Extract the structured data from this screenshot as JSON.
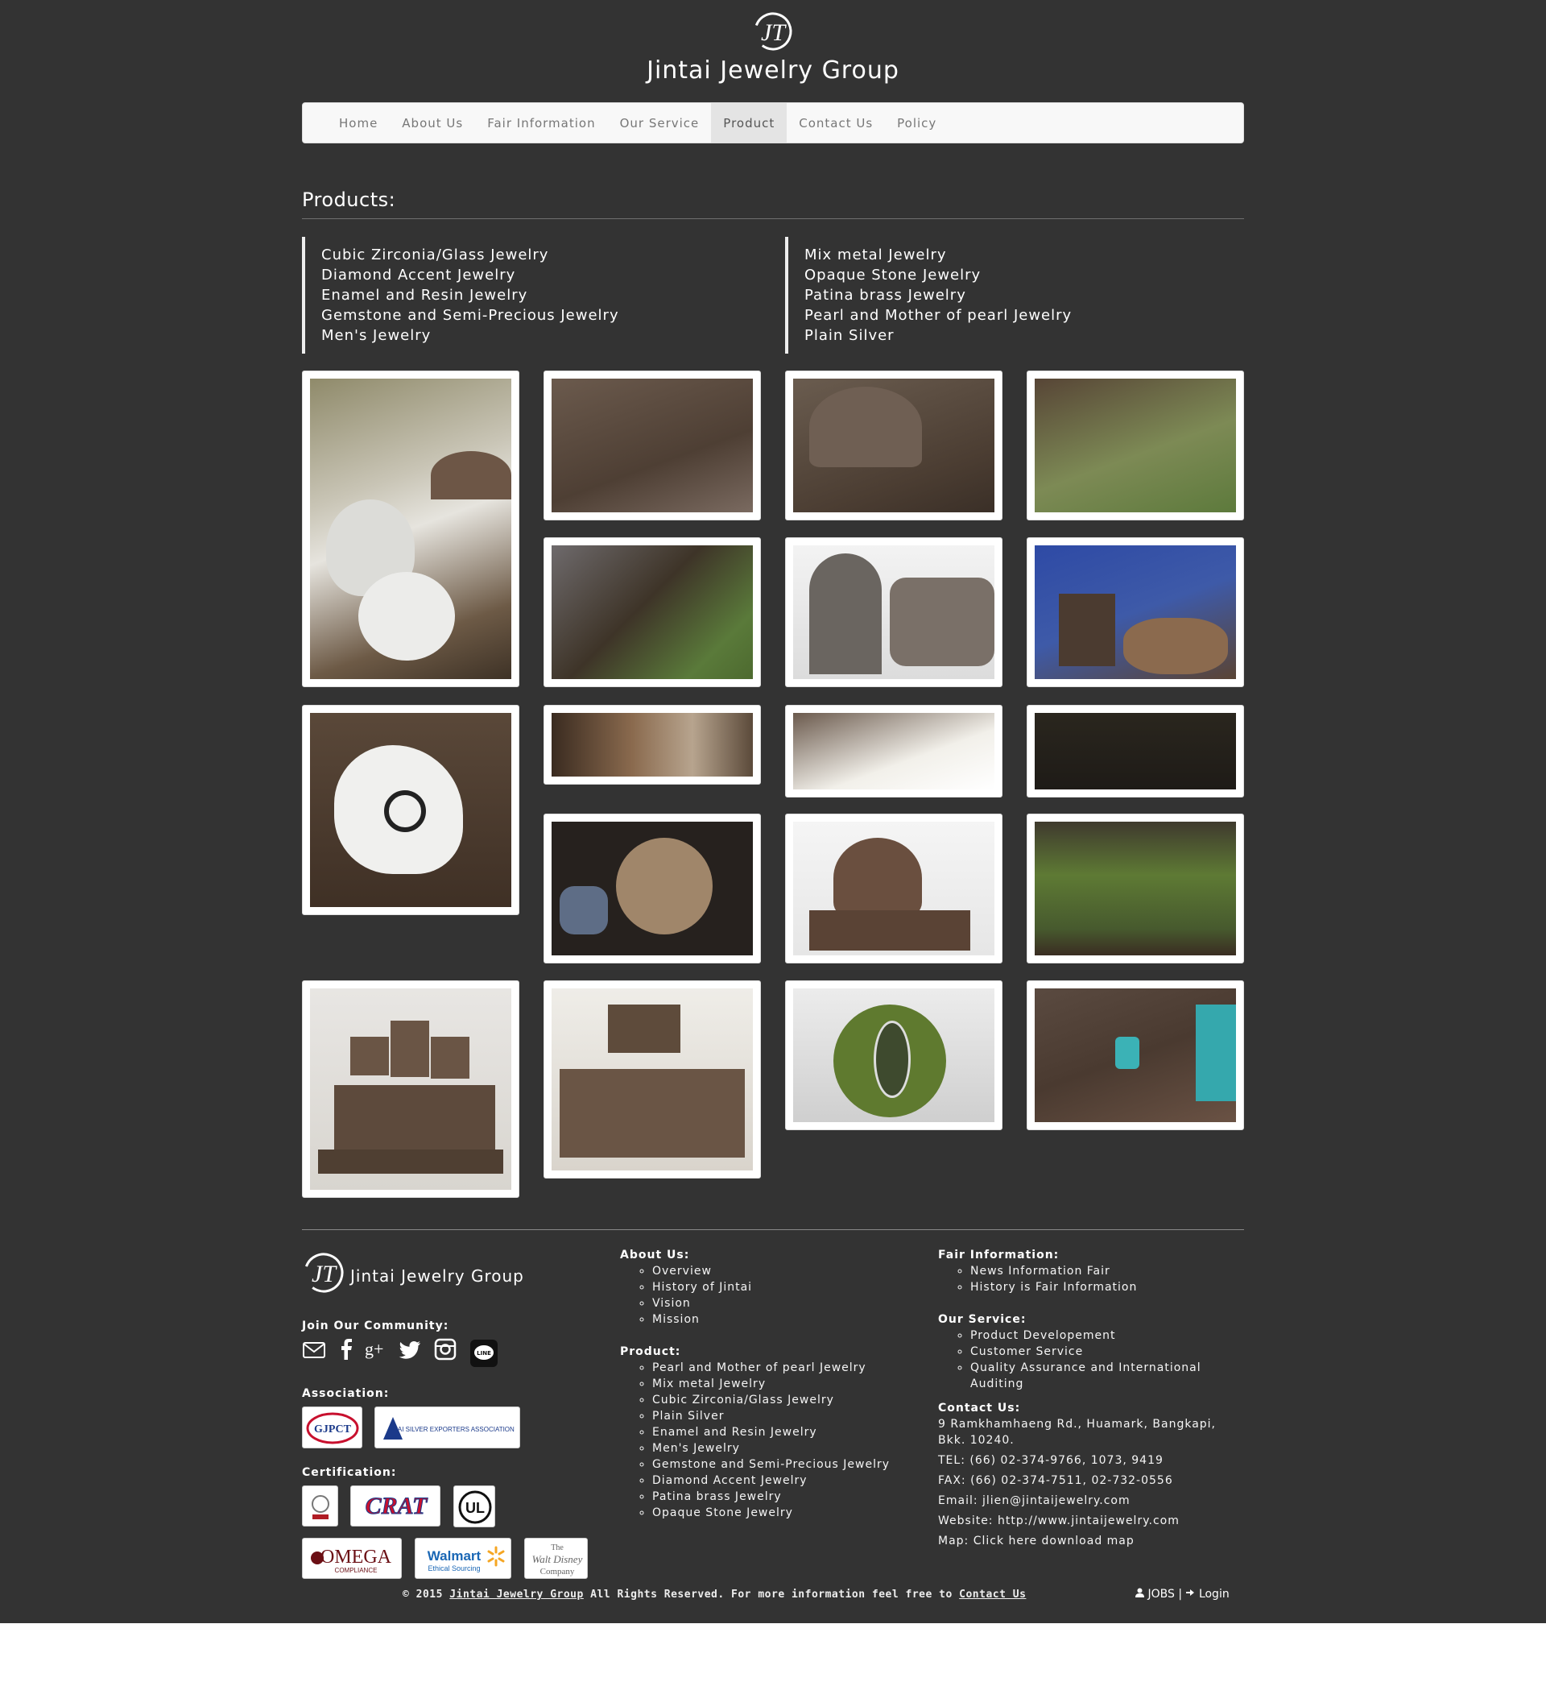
{
  "site": {
    "title": "Jintai Jewelry Group",
    "logo_letters": "JT"
  },
  "nav": {
    "items": [
      {
        "label": "Home"
      },
      {
        "label": "About Us"
      },
      {
        "label": "Fair Information"
      },
      {
        "label": "Our Service"
      },
      {
        "label": "Product",
        "active": true
      },
      {
        "label": "Contact Us"
      },
      {
        "label": "Policy"
      }
    ]
  },
  "products": {
    "heading": "Products:",
    "left": [
      "Cubic Zirconia/Glass Jewelry",
      "Diamond Accent Jewelry",
      "Enamel and Resin Jewelry",
      "Gemstone and Semi-Precious Jewelry",
      "Men's Jewelry"
    ],
    "right": [
      "Mix metal Jewelry",
      "Opaque Stone Jewelry",
      "Patina brass Jewelry",
      "Pearl and Mother of pearl Jewelry",
      "Plain Silver"
    ]
  },
  "footer": {
    "brand": "Jintai Jewelry Group",
    "community_heading": "Join Our Community:",
    "social_icons": [
      "email-icon",
      "facebook-icon",
      "google-plus-icon",
      "twitter-icon",
      "instagram-icon",
      "line-icon"
    ],
    "association_heading": "Association:",
    "association_badges": [
      "GJPCT",
      "THAI SILVER EXPORTERS ASSOCIATION"
    ],
    "certification_heading": "Certification:",
    "cert_badges": [
      "CRAT",
      "UL",
      "OMEGA",
      "COMPLIANCE",
      "Walmart",
      "Ethical Sourcing",
      "The",
      "Walt Disney",
      "Company"
    ],
    "about_heading": "About Us:",
    "about_items": [
      "Overview",
      "History of Jintai",
      "Vision",
      "Mission"
    ],
    "product_heading": "Product:",
    "product_items": [
      "Pearl and Mother of pearl Jewelry",
      "Mix metal Jewelry",
      "Cubic Zirconia/Glass Jewelry",
      "Plain Silver",
      "Enamel and Resin Jewelry",
      "Men's Jewelry",
      "Gemstone and Semi-Precious Jewelry",
      "Diamond Accent Jewelry",
      "Patina brass Jewelry",
      "Opaque Stone Jewelry"
    ],
    "fair_heading": "Fair Information:",
    "fair_items": [
      "News Information Fair",
      "History is Fair Information"
    ],
    "service_heading": "Our Service:",
    "service_items": [
      "Product Developement",
      "Customer Service",
      "Quality Assurance and International",
      "Auditing"
    ],
    "contact_heading": "Contact Us:",
    "address": "9 Ramkhamhaeng Rd., Huamark, Bangkapi,",
    "address2": "Bkk. 10240.",
    "tel": "TEL: (66) 02-374-9766, 1073, 9419",
    "fax": "FAX: (66) 02-374-7511, 02-732-0556",
    "email": "Email: jlien@jintaijewelry.com",
    "website": "Website: http://www.jintaijewelry.com",
    "map": "Map: Click here download map",
    "copyright_prefix": "© 2015",
    "copyright_link": "Jintai Jewelry Group",
    "copyright_mid": "All Rights Reserved. For more information feel free to",
    "copyright_contact": "Contact Us",
    "jobs": "JOBS",
    "login": "Login"
  },
  "colors": {
    "page_bg": "#333333",
    "nav_bg": "#f8f8f8",
    "nav_active": "#e4e4e4",
    "brown": "#5b4636"
  }
}
